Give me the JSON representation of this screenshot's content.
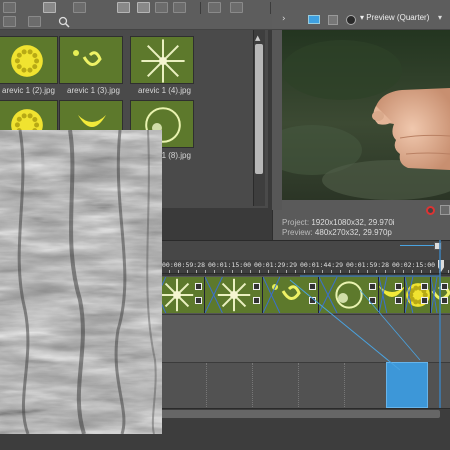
{
  "toolbar": {
    "buttons": [
      {
        "name": "folder-icon"
      },
      {
        "name": "tool-icon-2"
      },
      {
        "name": "import-icon"
      },
      {
        "name": "views-icon"
      },
      {
        "name": "search-icon"
      },
      {
        "name": "tool-icon-6"
      },
      {
        "name": "tool-icon-7"
      },
      {
        "name": "tool-icon-8"
      },
      {
        "name": "tool-icon-9"
      },
      {
        "name": "tool-icon-10"
      }
    ]
  },
  "media": {
    "items": [
      {
        "label": "",
        "variant": "dots"
      },
      {
        "label": "",
        "variant": "swirl"
      },
      {
        "label": "",
        "variant": "star"
      },
      {
        "label": "arevic 1 (2).jpg",
        "variant": "dots"
      },
      {
        "label": "arevic 1 (3).jpg",
        "variant": "swirl"
      },
      {
        "label": "arevic 1 (4).jpg",
        "variant": "star"
      },
      {
        "label": "",
        "variant": "dots"
      },
      {
        "label": "",
        "variant": "flower"
      },
      {
        "label": "",
        "variant": "glow"
      },
      {
        "label": "",
        "variant": ""
      },
      {
        "label": "",
        "variant": ""
      },
      {
        "label": "arevic 1 (8).jpg",
        "variant": ""
      }
    ]
  },
  "preview": {
    "dropdown_label": "Preview (Quarter)",
    "project_label": "Project:",
    "project_value": "1920x1080x32, 29.970i",
    "preview_label": "Preview:",
    "preview_value": "480x270x32, 29.970p"
  },
  "timeline": {
    "ruler_labels": [
      "00:00:59:28",
      "00:01:15:00",
      "00:01:29:29",
      "00:01:44:29",
      "00:01:59:28",
      "00:02:15:00"
    ]
  },
  "colors": {
    "selection_blue": "#3d97d8",
    "clip_green": "#7a8a1f"
  }
}
